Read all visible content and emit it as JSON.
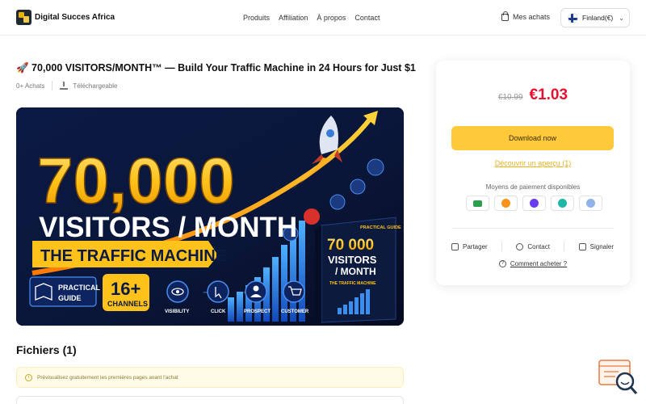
{
  "header": {
    "brand": "Digital Succes Africa",
    "nav": [
      "Produits",
      "Affiliation",
      "À propos",
      "Contact"
    ],
    "purchases_label": "Mes achats",
    "region_label": "Finland(€)"
  },
  "product": {
    "title": "🚀 70,000 VISITORS/MONTH™ — Build Your Traffic Machine in 24 Hours for Just $1",
    "purchases": "0+ Achats",
    "format": "Téléchargeable"
  },
  "banner": {
    "big_number": "70,000",
    "headline": "VISITORS / MONTH",
    "ribbon": "THE TRAFFIC MACHINE",
    "practical_1": "PRACTICAL",
    "practical_2": "GUIDE",
    "channels_1": "16+",
    "channels_2": "CHANNELS",
    "steps": [
      "VISIBILITY",
      "CLICK",
      "PROSPECT",
      "CUSTOMER"
    ],
    "book_tag": "PRACTICAL GUIDE",
    "book_number": "70 000",
    "book_line1": "VISITORS",
    "book_line2": "/ MONTH",
    "book_sub": "THE TRAFFIC MACHINE"
  },
  "files": {
    "title": "Fichiers (1)",
    "notice": "Prévisualisez gratuitement les premières pages avant l'achat"
  },
  "purchase": {
    "old_price": "€10.99",
    "new_price": "€1.03",
    "buy_label": "Download now",
    "preview_label": "Découvrir un aperçu (1)",
    "payment_label": "Moyens de paiement disponibles",
    "payment_methods": [
      {
        "icon": "card-icon",
        "color": "#2e9e4f"
      },
      {
        "icon": "bitcoin-icon",
        "color": "#f7931a"
      },
      {
        "icon": "ethereum-icon",
        "color": "#6a3df0"
      },
      {
        "icon": "gem-icon",
        "color": "#1fb7a6"
      },
      {
        "icon": "globe-icon",
        "color": "#8fb3e8"
      }
    ],
    "share_label": "Partager",
    "contact_label": "Contact",
    "report_label": "Signaler",
    "how_to_buy": "Comment acheter ?"
  },
  "colors": {
    "accent_yellow": "#ffc93c",
    "price_red": "#e8102e",
    "banner_bg": "#081330"
  }
}
